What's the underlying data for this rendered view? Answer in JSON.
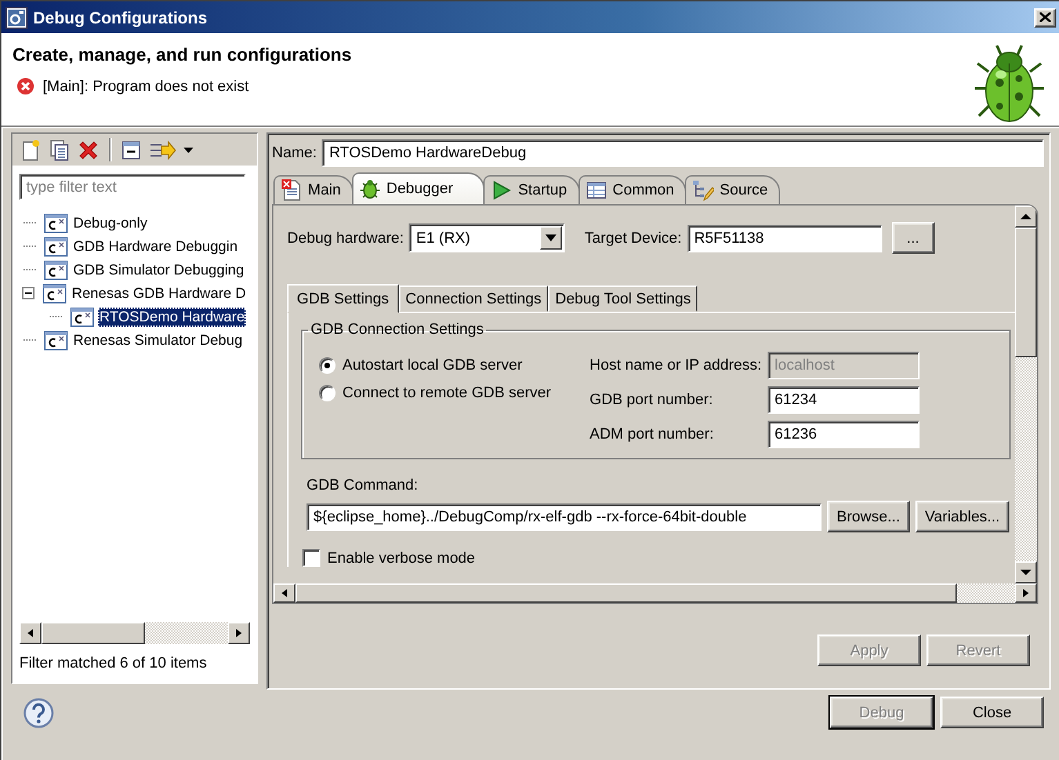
{
  "window": {
    "title": "Debug Configurations"
  },
  "header": {
    "title": "Create, manage, and run configurations",
    "message": "[Main]: Program does not exist"
  },
  "sidebar": {
    "filter": {
      "placeholder": "type filter text"
    },
    "tree": [
      {
        "label": "Debug-only",
        "selected": false
      },
      {
        "label": "GDB Hardware Debuggin",
        "selected": false
      },
      {
        "label": "GDB Simulator Debugging",
        "selected": false
      },
      {
        "label": "Renesas GDB Hardware D",
        "selected": false,
        "expanded": true,
        "children": [
          {
            "label": "RTOSDemo Hardware",
            "selected": true
          }
        ]
      },
      {
        "label": "Renesas Simulator Debug",
        "selected": false
      }
    ],
    "status": "Filter matched 6 of 10 items"
  },
  "editor": {
    "name_label": "Name:",
    "name_value": "RTOSDemo HardwareDebug",
    "tabs": [
      {
        "label": "Main",
        "kind": "main",
        "selected": false
      },
      {
        "label": "Debugger",
        "kind": "debugger",
        "selected": true
      },
      {
        "label": "Startup",
        "kind": "startup",
        "selected": false
      },
      {
        "label": "Common",
        "kind": "common",
        "selected": false
      },
      {
        "label": "Source",
        "kind": "source",
        "selected": false
      }
    ],
    "debug_hardware": {
      "label": "Debug hardware:",
      "value": "E1 (RX)"
    },
    "target_device": {
      "label": "Target Device:",
      "value": "R5F51138",
      "button": "..."
    },
    "subtabs": [
      {
        "label": "GDB Settings",
        "selected": true
      },
      {
        "label": "Connection Settings",
        "selected": false
      },
      {
        "label": "Debug Tool Settings",
        "selected": false
      }
    ],
    "group": {
      "title": "GDB Connection Settings",
      "options": [
        {
          "label": "Autostart local GDB server",
          "selected": true
        },
        {
          "label": "Connect to remote GDB server",
          "selected": false
        }
      ],
      "fields": [
        {
          "label": "Host name or IP address:",
          "value": "localhost",
          "disabled": true
        },
        {
          "label": "GDB port number:",
          "value": "61234",
          "disabled": false
        },
        {
          "label": "ADM port number:",
          "value": "61236",
          "disabled": false
        }
      ]
    },
    "gdb_command": {
      "label": "GDB Command:",
      "value": "${eclipse_home}../DebugComp/rx-elf-gdb --rx-force-64bit-double",
      "buttons": [
        "Browse...",
        "Variables..."
      ]
    },
    "verbose": {
      "label": "Enable verbose mode",
      "checked": false
    },
    "buttons": [
      {
        "label": "Apply",
        "disabled": true
      },
      {
        "label": "Revert",
        "disabled": true
      }
    ]
  },
  "footer": {
    "buttons": [
      {
        "label": "Debug",
        "disabled": true,
        "default": true
      },
      {
        "label": "Close",
        "disabled": false,
        "default": false
      }
    ]
  }
}
